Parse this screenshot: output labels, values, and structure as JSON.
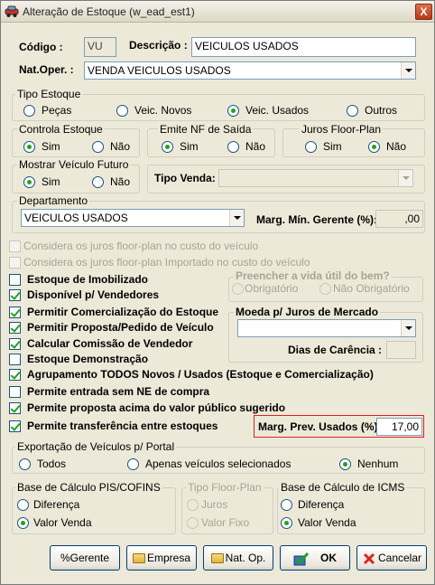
{
  "window": {
    "title": "Alteração de Estoque (w_ead_est1)",
    "close_label": "X"
  },
  "header": {
    "codigo_label": "Código :",
    "codigo_value": "VU",
    "descricao_label": "Descrição :",
    "descricao_value": "VEICULOS USADOS",
    "natoper_label": "Nat.Oper. :",
    "natoper_value": "VENDA VEICULOS USADOS"
  },
  "tipo_estoque": {
    "title": "Tipo Estoque",
    "options": [
      "Peças",
      "Veic. Novos",
      "Veic. Usados",
      "Outros"
    ],
    "selected": "Veic. Usados"
  },
  "controla_estoque": {
    "title": "Controla Estoque",
    "options": [
      "Sim",
      "Não"
    ],
    "selected": "Sim"
  },
  "emite_nf": {
    "title": "Emite NF de Saída",
    "options": [
      "Sim",
      "Não"
    ],
    "selected": "Sim"
  },
  "juros_floor": {
    "title": "Juros Floor-Plan",
    "options": [
      "Sim",
      "Não"
    ],
    "selected": "Não"
  },
  "mostrar_veiculo": {
    "title": "Mostrar Veículo Futuro",
    "options": [
      "Sim",
      "Não"
    ],
    "selected": "Sim"
  },
  "tipo_venda": {
    "label": "Tipo Venda:",
    "value": ""
  },
  "departamento": {
    "title": "Departamento",
    "value": "VEICULOS USADOS"
  },
  "marg_min": {
    "label": "Marg. Mín. Gerente (%):",
    "value": ",00"
  },
  "checks": [
    {
      "label": "Considera os juros floor-plan no custo do veículo",
      "checked": false,
      "disabled": true
    },
    {
      "label": "Considera os juros floor-plan Importado no custo do veículo",
      "checked": false,
      "disabled": true
    },
    {
      "label": "Estoque de Imobilizado",
      "checked": false,
      "disabled": false
    },
    {
      "label": "Disponível p/ Vendedores",
      "checked": true,
      "disabled": false
    },
    {
      "label": "Permitir Comercialização do Estoque",
      "checked": true,
      "disabled": false
    },
    {
      "label": "Permitir Proposta/Pedido de Veículo",
      "checked": true,
      "disabled": false
    },
    {
      "label": "Calcular Comissão de Vendedor",
      "checked": true,
      "disabled": false
    },
    {
      "label": "Estoque Demonstração",
      "checked": false,
      "disabled": false
    },
    {
      "label": "Agrupamento TODOS Novos / Usados (Estoque e Comercialização)",
      "checked": true,
      "disabled": false
    },
    {
      "label": "Permite entrada sem NE de compra",
      "checked": false,
      "disabled": false
    },
    {
      "label": "Permite proposta acima do valor público sugerido",
      "checked": true,
      "disabled": false
    },
    {
      "label": "Permite transferência entre estoques",
      "checked": true,
      "disabled": false
    }
  ],
  "vida_util": {
    "title": "Preencher a vida útil do bem?",
    "options": [
      "Obrigatório",
      "Não Obrigatório"
    ]
  },
  "moeda": {
    "title": "Moeda p/ Juros de Mercado",
    "value": ""
  },
  "dias_carencia": {
    "label": "Dias de Carência :",
    "value": ""
  },
  "marg_prev": {
    "label": "Marg. Prev. Usados (%):",
    "value": "17,00"
  },
  "exportacao": {
    "title": "Exportação de Veículos p/ Portal",
    "options": [
      "Todos",
      "Apenas veículos selecionados",
      "Nenhum"
    ],
    "selected": "Nenhum"
  },
  "pis_cofins": {
    "title": "Base de Cálculo PIS/COFINS",
    "options": [
      "Diferença",
      "Valor Venda"
    ],
    "selected": "Valor Venda"
  },
  "tipo_floor": {
    "title": "Tipo Floor-Plan",
    "options": [
      "Juros",
      "Valor Fixo"
    ]
  },
  "icms": {
    "title": "Base de Cálculo de ICMS",
    "options": [
      "Diferença",
      "Valor Venda"
    ],
    "selected": "Valor Venda"
  },
  "buttons": {
    "gerente": "%Gerente",
    "empresa": "Empresa",
    "natop": "Nat. Op.",
    "ok": "OK",
    "cancelar": "Cancelar"
  },
  "colors": {
    "accent_green": "#21a121",
    "highlight_red": "#dd2222",
    "window_bg": "#ece9d8"
  }
}
